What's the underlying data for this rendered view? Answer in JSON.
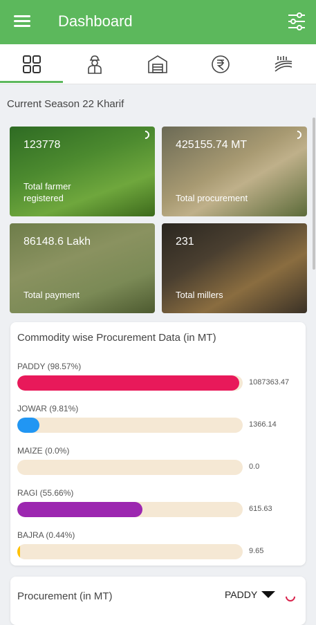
{
  "appbar": {
    "title": "Dashboard"
  },
  "tabs": [
    {
      "icon": "grid-icon"
    },
    {
      "icon": "farmer-icon"
    },
    {
      "icon": "warehouse-icon"
    },
    {
      "icon": "rupee-icon"
    },
    {
      "icon": "field-icon"
    }
  ],
  "season": "Current Season 22 Kharif",
  "stats": [
    {
      "value": "123778",
      "label": "Total farmer registered"
    },
    {
      "value": "425155.74 MT",
      "label": "Total procurement"
    },
    {
      "value": "86148.6 Lakh",
      "label": "Total payment"
    },
    {
      "value": "231",
      "label": "Total millers"
    }
  ],
  "commodity": {
    "title": "Commodity wise Procurement Data (in MT)",
    "rows": [
      {
        "name": "PADDY (98.57%)",
        "percent": 98.57,
        "value": "1087363.47",
        "color": "#e8195a"
      },
      {
        "name": "JOWAR (9.81%)",
        "percent": 9.81,
        "value": "1366.14",
        "color": "#2196f3"
      },
      {
        "name": "MAIZE (0.0%)",
        "percent": 0.0,
        "value": "0.0",
        "color": "#ff9800"
      },
      {
        "name": "RAGI (55.66%)",
        "percent": 55.66,
        "value": "615.63",
        "color": "#9c27b0"
      },
      {
        "name": "BAJRA (0.44%)",
        "percent": 0.44,
        "value": "9.65",
        "color": "#ffc107"
      }
    ]
  },
  "procurement": {
    "title": "Procurement (in MT)",
    "selected": "PADDY"
  },
  "colors": {
    "primary": "#5cb85c"
  }
}
